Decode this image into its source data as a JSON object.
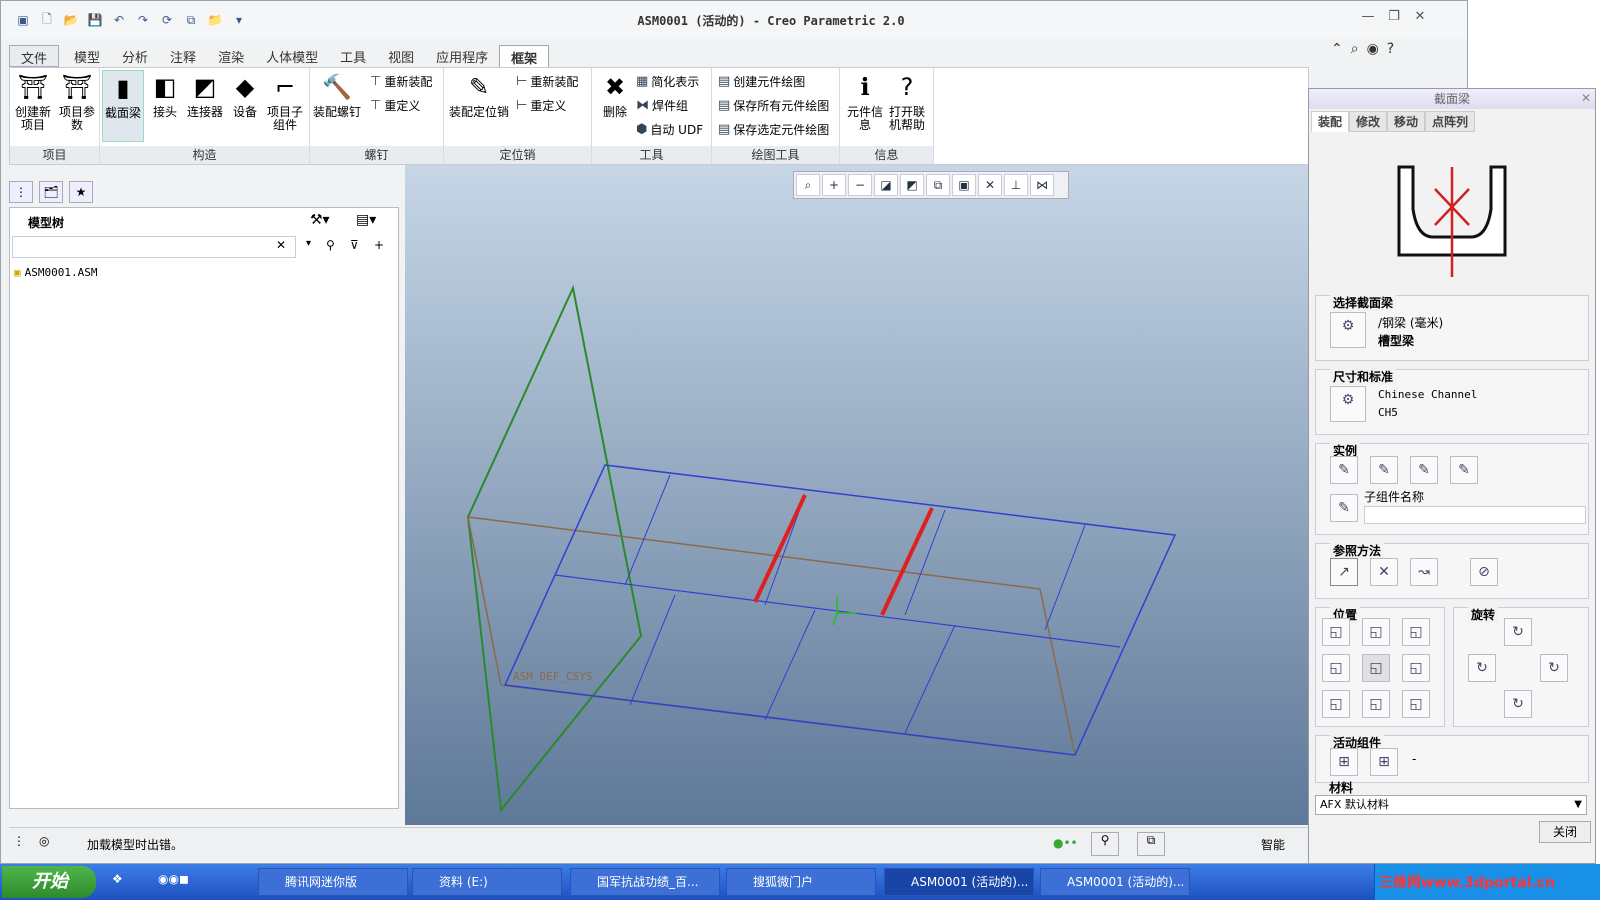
{
  "window": {
    "title": "ASM0001 (活动的) - Creo Parametric 2.0",
    "accent": "#3a6ea5"
  },
  "tabs": [
    "文件",
    "模型",
    "分析",
    "注释",
    "渲染",
    "人体模型",
    "工具",
    "视图",
    "应用程序",
    "框架"
  ],
  "ribbon": {
    "groups": [
      "项目",
      "构造",
      "螺钉",
      "定位销",
      "工具",
      "绘图工具",
      "信息"
    ],
    "buttons": {
      "create_item": "创建新项目",
      "item_params": "项目参数",
      "section_beam": "截面梁",
      "joint": "接头",
      "connector": "连接器",
      "device": "设备",
      "sub_assembly": "项目子组件",
      "assemble_screw": "装配螺钉",
      "reassemble1": "重新装配",
      "redefine1": "重定义",
      "assemble_pin": "装配定位销",
      "reassemble2": "重新装配",
      "redefine2": "重定义",
      "delete": "删除",
      "simplified": "简化表示",
      "weld_group": "焊件组",
      "auto_udf": "自动 UDF",
      "create_drawing": "创建元件绘图",
      "save_all_drawings": "保存所有元件绘图",
      "save_selected_drawings": "保存选定元件绘图",
      "comp_info": "元件信息",
      "open_help": "打开联机帮助"
    }
  },
  "model_tree": {
    "title": "模型树",
    "root": "ASM0001.ASM"
  },
  "viewport": {
    "csys_label": "ASM_DEF_CSYS"
  },
  "status": {
    "message": "加载模型时出错。",
    "smart": "智能"
  },
  "panel": {
    "title": "截面梁",
    "tabs": [
      "装配",
      "修改",
      "移动",
      "点阵列"
    ],
    "select_header": "选择截面梁",
    "beam_path": "/钢梁 (毫米)",
    "beam_type": "槽型梁",
    "size_header": "尺寸和标准",
    "standard": "Chinese Channel",
    "size": "CH5",
    "instance_header": "实例",
    "sub_name_label": "子组件名称",
    "ref_header": "参照方法",
    "pos_header": "位置",
    "rot_header": "旋转",
    "active_header": "活动组件",
    "active_value": "-",
    "material_header": "材料",
    "material_value": "AFX 默认材料",
    "close": "关闭"
  },
  "taskbar": {
    "start": "开始",
    "items": [
      "腾讯网迷你版",
      "资料 (E:)",
      "国军抗战功绩_百...",
      "搜狐微门户",
      "ASM0001 (活动的)...",
      "ASM0001 (活动的)..."
    ],
    "watermark": "三维网www.3dportal.cn"
  }
}
